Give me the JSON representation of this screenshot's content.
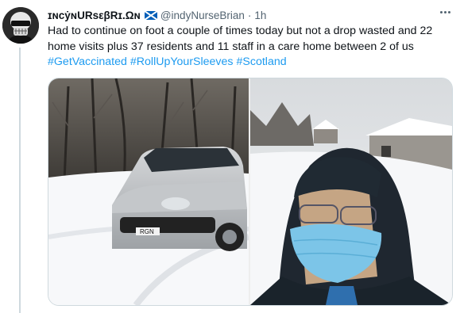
{
  "tweet": {
    "display_name": "ɪɴᴄẏɴURsεβRɪ.Ωɴ",
    "handle": "@indyNurseBrian",
    "separator": "·",
    "time": "1h",
    "text_main": "Had to continue on foot a couple of times today but not a drop wasted and 22 home visits plus 37 residents and 11 staff in a care home between 2 of us",
    "hashtags": [
      "#GetVaccinated",
      "#RollUpYourSleeves",
      "#Scotland"
    ]
  },
  "media": {
    "photo_left_desc": "silver car parked in snow",
    "photo_right_desc": "selfie in snow with face mask",
    "license_plate": "RGN"
  },
  "colors": {
    "accent": "#1d9bf0",
    "secondary_text": "#536471",
    "flag_blue": "#005eb8"
  },
  "icons": {
    "avatar": "skull-avatar-icon",
    "flag": "scotland-flag-icon",
    "more": "more-options-icon"
  }
}
